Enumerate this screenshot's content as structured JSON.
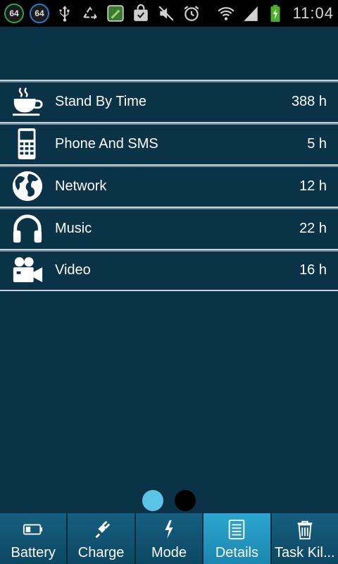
{
  "status_bar": {
    "badge1": "64",
    "badge2": "64",
    "time": "11:04",
    "icons": [
      "badge-icon",
      "usb-icon",
      "recycle-icon",
      "app-icon",
      "shopping-bag-icon",
      "mute-icon",
      "alarm-icon",
      "wifi-icon",
      "signal-icon",
      "battery-charging-icon"
    ]
  },
  "list": {
    "items": [
      {
        "label": "Stand By Time",
        "value": "388 h",
        "icon": "coffee-cup-icon"
      },
      {
        "label": "Phone And SMS",
        "value": "5 h",
        "icon": "phone-icon"
      },
      {
        "label": "Network",
        "value": "12 h",
        "icon": "globe-icon"
      },
      {
        "label": "Music",
        "value": "22 h",
        "icon": "headphones-icon"
      },
      {
        "label": "Video",
        "value": "16 h",
        "icon": "video-camera-icon"
      }
    ]
  },
  "pager": {
    "active_index": 0,
    "count": 2
  },
  "tabs": [
    {
      "label": "Battery",
      "icon": "battery-icon"
    },
    {
      "label": "Charge",
      "icon": "plug-icon"
    },
    {
      "label": "Mode",
      "icon": "lightning-icon"
    },
    {
      "label": "Details",
      "icon": "document-icon",
      "selected": true
    },
    {
      "label": "Task Kil...",
      "icon": "trash-icon"
    }
  ],
  "colors": {
    "background": "#0a3348",
    "active_dot": "#5bc3e6",
    "selected_tab": "#2da7d0",
    "tab": "#165f80"
  }
}
